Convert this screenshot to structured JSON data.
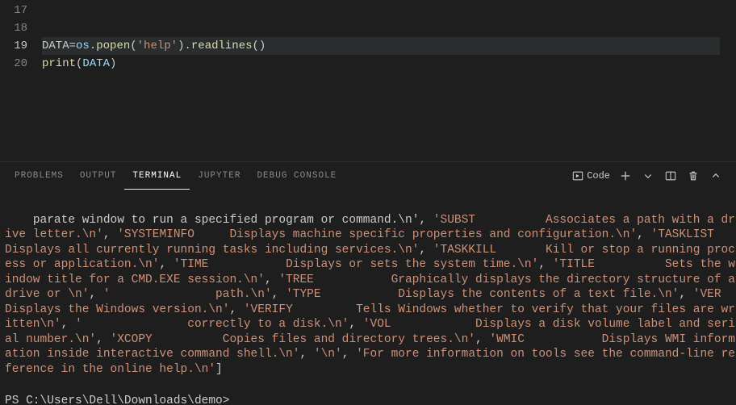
{
  "editor": {
    "lines": [
      {
        "num": "17",
        "tokens": []
      },
      {
        "num": "18",
        "tokens": []
      },
      {
        "num": "19",
        "current": true,
        "tokens": [
          {
            "t": "DATA",
            "c": "tok-var"
          },
          {
            "t": "=",
            "c": "tok-punct"
          },
          {
            "t": "os",
            "c": "tok-ident"
          },
          {
            "t": ".",
            "c": "tok-punct"
          },
          {
            "t": "popen",
            "c": "tok-func"
          },
          {
            "t": "(",
            "c": "tok-punct"
          },
          {
            "t": "'help'",
            "c": "tok-str"
          },
          {
            "t": ")",
            "c": "tok-punct"
          },
          {
            "t": ".",
            "c": "tok-punct"
          },
          {
            "t": "readlines",
            "c": "tok-func"
          },
          {
            "t": "()",
            "c": "tok-punct"
          }
        ]
      },
      {
        "num": "20",
        "tokens": [
          {
            "t": "print",
            "c": "tok-call"
          },
          {
            "t": "(",
            "c": "tok-punct"
          },
          {
            "t": "DATA",
            "c": "tok-ident"
          },
          {
            "t": ")",
            "c": "tok-punct"
          }
        ]
      }
    ]
  },
  "panel": {
    "tabs": [
      {
        "key": "problems",
        "label": "PROBLEMS",
        "active": false
      },
      {
        "key": "output",
        "label": "OUTPUT",
        "active": false
      },
      {
        "key": "terminal",
        "label": "TERMINAL",
        "active": true
      },
      {
        "key": "jupyter",
        "label": "JUPYTER",
        "active": false
      },
      {
        "key": "debug",
        "label": "DEBUG CONSOLE",
        "active": false
      }
    ],
    "launch_label": "Code"
  },
  "terminal": {
    "segments": [
      {
        "c": "term-plain",
        "t": "parate window to run a specified program or command.\\n', "
      },
      {
        "c": "term-str",
        "t": "'SUBST          Associates a path with a drive letter.\\n'"
      },
      {
        "c": "term-plain",
        "t": ", "
      },
      {
        "c": "term-str",
        "t": "'SYSTEMINFO     Displays machine specific properties and configuration.\\n'"
      },
      {
        "c": "term-plain",
        "t": ", "
      },
      {
        "c": "term-str",
        "t": "'TASKLIST       Displays all currently running tasks including services.\\n'"
      },
      {
        "c": "term-plain",
        "t": ", "
      },
      {
        "c": "term-str",
        "t": "'TASKKILL       Kill or stop a running process or application.\\n'"
      },
      {
        "c": "term-plain",
        "t": ", "
      },
      {
        "c": "term-str",
        "t": "'TIME           Displays or sets the system time.\\n'"
      },
      {
        "c": "term-plain",
        "t": ", "
      },
      {
        "c": "term-str",
        "t": "'TITLE          Sets the window title for a CMD.EXE session.\\n'"
      },
      {
        "c": "term-plain",
        "t": ", "
      },
      {
        "c": "term-str",
        "t": "'TREE           Graphically displays the directory structure of a drive or \\n'"
      },
      {
        "c": "term-plain",
        "t": ", "
      },
      {
        "c": "term-str",
        "t": "'               path.\\n'"
      },
      {
        "c": "term-plain",
        "t": ", "
      },
      {
        "c": "term-str",
        "t": "'TYPE           Displays the contents of a text file.\\n'"
      },
      {
        "c": "term-plain",
        "t": ", "
      },
      {
        "c": "term-str",
        "t": "'VER            Displays the Windows version.\\n'"
      },
      {
        "c": "term-plain",
        "t": ", "
      },
      {
        "c": "term-str",
        "t": "'VERIFY         Tells Windows whether to verify that your files are written\\n'"
      },
      {
        "c": "term-plain",
        "t": ", "
      },
      {
        "c": "term-str",
        "t": "'               correctly to a disk.\\n'"
      },
      {
        "c": "term-plain",
        "t": ", "
      },
      {
        "c": "term-str",
        "t": "'VOL            Displays a disk volume label and serial number.\\n'"
      },
      {
        "c": "term-plain",
        "t": ", "
      },
      {
        "c": "term-str",
        "t": "'XCOPY          Copies files and directory trees.\\n'"
      },
      {
        "c": "term-plain",
        "t": ", "
      },
      {
        "c": "term-str",
        "t": "'WMIC           Displays WMI information inside interactive command shell.\\n'"
      },
      {
        "c": "term-plain",
        "t": ", "
      },
      {
        "c": "term-str",
        "t": "'\\n'"
      },
      {
        "c": "term-plain",
        "t": ", "
      },
      {
        "c": "term-str",
        "t": "'For more information on tools see the command-line reference in the online help.\\n'"
      },
      {
        "c": "term-plain",
        "t": "]"
      }
    ],
    "prompt": "PS C:\\Users\\Dell\\Downloads\\demo>"
  }
}
